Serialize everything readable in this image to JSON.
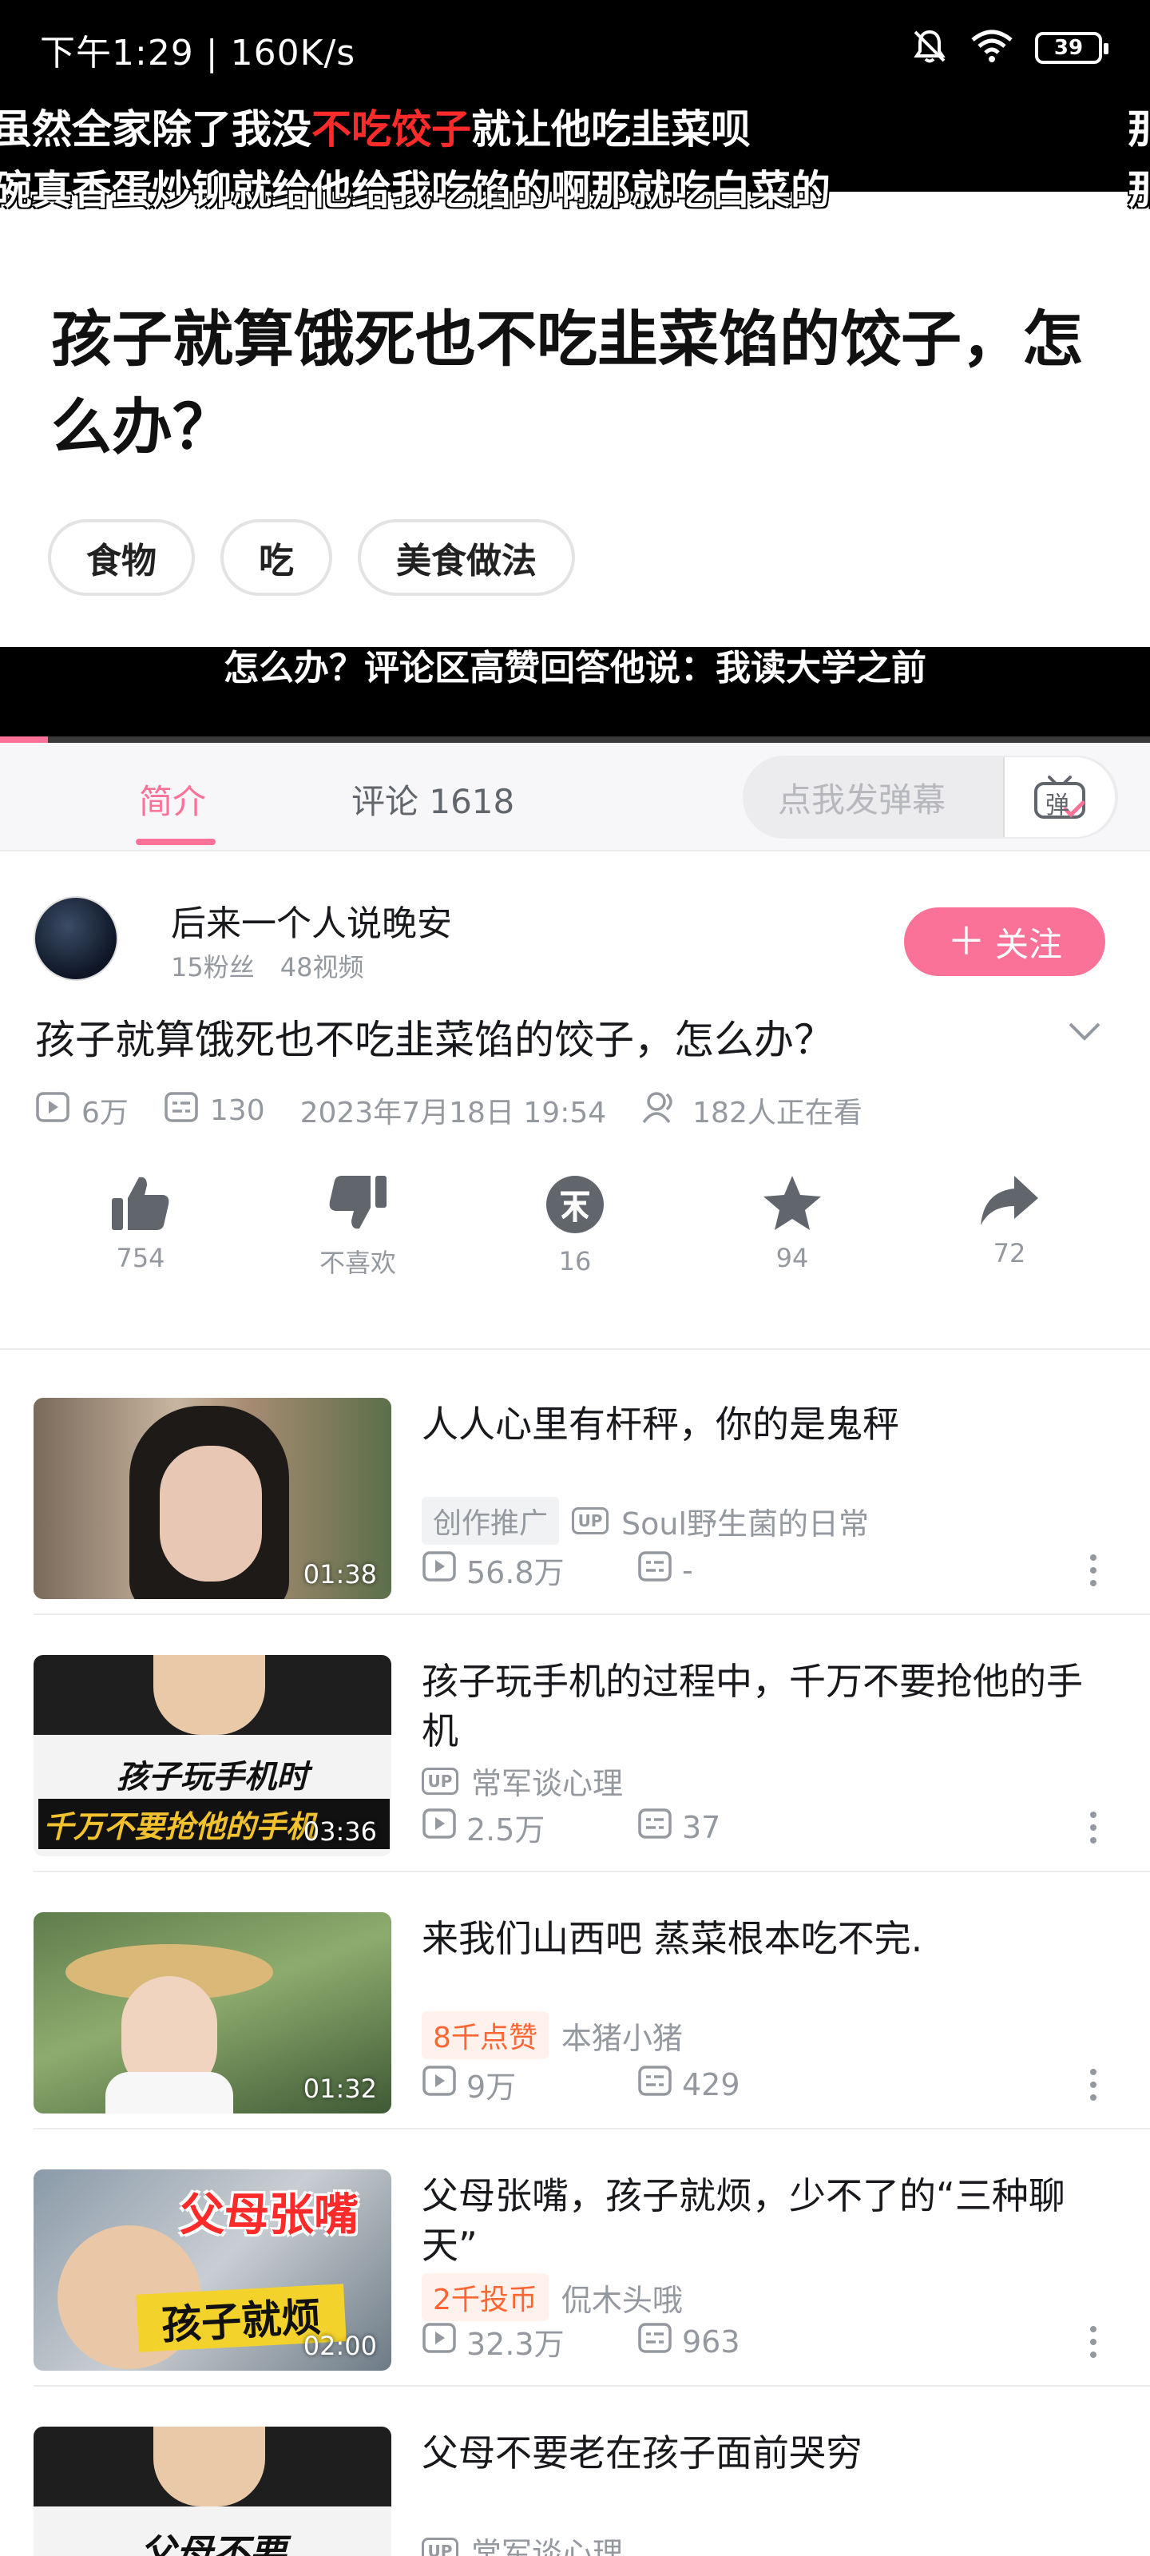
{
  "status_bar": {
    "time": "下午1:29 | 160K/s",
    "battery": "39"
  },
  "player": {
    "danmaku": {
      "line1_left": "虽然全家除了我没",
      "line1_highlight": "不吃饺子",
      "line1_right": "就让他吃韭菜呗",
      "line1_edge": "那",
      "line2": "碗真香蛋炒铆就给他给我吃馅的啊那就吃白菜的",
      "line2_edge": "那"
    },
    "frame_title": "孩子就算饿死也不吃韭菜馅的饺子，怎么办？",
    "frame_tags": [
      "食物",
      "吃",
      "美食做法"
    ],
    "subtitle": "怎么办？评论区高赞回答他说：我读大学之前",
    "progress_fraction": 0.042
  },
  "tabs": {
    "intro": "简介",
    "comments": "评论 1618",
    "danmaku_placeholder": "点我发弹幕",
    "danmaku_toggle_char": "弹"
  },
  "uploader": {
    "name": "后来一个人说晚安",
    "stats": "15粉丝　48视频",
    "follow_label": "关注"
  },
  "video": {
    "title": "孩子就算饿死也不吃韭菜馅的饺子，怎么办？",
    "views": "6万",
    "danmaku_count": "130",
    "date": "2023年7月18日 19:54",
    "watching": "182人正在看"
  },
  "actions": {
    "like": "754",
    "dislike": "不喜欢",
    "coin": "16",
    "favorite": "94",
    "share": "72"
  },
  "recommendations": [
    {
      "title": "人人心里有杆秤，你的是鬼秤",
      "duration": "01:38",
      "badge": "创作推广",
      "badge_type": "gray",
      "show_up_tag": true,
      "uploader": "Soul野生菌的日常",
      "views": "56.8万",
      "danmaku": "-"
    },
    {
      "title": "孩子玩手机的过程中，千万不要抢他的手机",
      "duration": "03:36",
      "badge": "",
      "badge_type": "none",
      "show_up_tag": true,
      "uploader": "常军谈心理",
      "views": "2.5万",
      "danmaku": "37",
      "thumb_text1": "孩子玩手机时",
      "thumb_text2": "千万不要抢他的手机"
    },
    {
      "title": "来我们山西吧 蒸菜根本吃不完.",
      "duration": "01:32",
      "badge": "8千点赞",
      "badge_type": "orange",
      "show_up_tag": false,
      "uploader": "本猪小猪",
      "views": "9万",
      "danmaku": "429"
    },
    {
      "title": "父母张嘴，孩子就烦，少不了的“三种聊天”",
      "duration": "02:00",
      "badge": "2千投币",
      "badge_type": "orange",
      "show_up_tag": false,
      "uploader": "侃木头哦",
      "views": "32.3万",
      "danmaku": "963",
      "thumb_text1": "父母张嘴",
      "thumb_text2": "孩子就烦"
    },
    {
      "title": "父母不要老在孩子面前哭穷",
      "duration": "",
      "badge": "",
      "badge_type": "none",
      "show_up_tag": true,
      "uploader": "常军谈心理",
      "views": "",
      "danmaku": "",
      "thumb_text1": "父母不要"
    }
  ],
  "colors": {
    "accent": "#fb7299",
    "muted": "#9499a0",
    "danmaku_highlight": "#ff2b2b",
    "badge_orange": "#ff6633"
  },
  "icons": [
    "mute-bell-icon",
    "wifi-icon",
    "battery-icon",
    "danmaku-toggle-icon",
    "play-count-icon",
    "danmaku-count-icon",
    "watching-icon",
    "thumbs-up-icon",
    "thumbs-down-icon",
    "coin-icon",
    "star-icon",
    "share-icon",
    "chevron-down-icon",
    "more-icon",
    "up-tag-icon"
  ]
}
